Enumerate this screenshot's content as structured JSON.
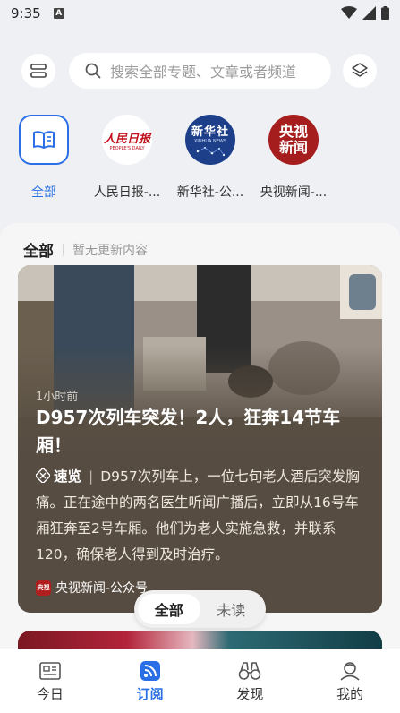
{
  "status_bar": {
    "time": "9:35",
    "notif_letter": "A"
  },
  "search": {
    "placeholder": "搜索全部专题、文章或者频道"
  },
  "icons": {
    "left": "list-icon",
    "search": "search-icon",
    "right": "layers-icon"
  },
  "channels": [
    {
      "name": "全部",
      "icon": "book-icon"
    },
    {
      "name": "人民日报-...",
      "logo_text": "人民日报"
    },
    {
      "name": "新华社-公...",
      "logo_text": "新华社",
      "logo_sub": "XINHUA NEWS"
    },
    {
      "name": "央视新闻-...",
      "logo_text_top": "央视",
      "logo_text_bottom": "新闻"
    }
  ],
  "feed": {
    "title": "全部",
    "subtitle": "暂无更新内容"
  },
  "card": {
    "time": "1小时前",
    "headline": "D957次列车突发！2人，狂奔14节车厢！",
    "tag": "速览",
    "summary": "D957次列车上，一位七旬老人酒后突发胸痛。正在途中的两名医生听闻广播后，立即从16号车厢狂奔至2号车厢。他们为老人实施急救，并联系120，确保老人得到及时治疗。",
    "source": "央视新闻-公众号"
  },
  "toggle": {
    "all": "全部",
    "unread": "未读"
  },
  "tabs": [
    {
      "label": "今日",
      "icon": "newspaper-icon"
    },
    {
      "label": "订阅",
      "icon": "rss-icon"
    },
    {
      "label": "发现",
      "icon": "binoculars-icon"
    },
    {
      "label": "我的",
      "icon": "user-icon"
    }
  ],
  "colors": {
    "accent": "#2a6fe6",
    "cctv_red": "#a51d1d",
    "xinhua_blue": "#1d3f8a",
    "renmin_red": "#c0121c"
  }
}
